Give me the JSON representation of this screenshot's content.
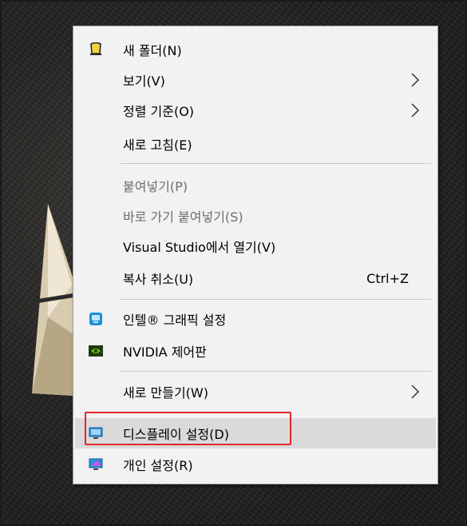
{
  "menu": {
    "items": [
      {
        "label": "새 폴더(N)",
        "icon": "folder-icon"
      },
      {
        "label": "보기(V)",
        "submenu": true
      },
      {
        "label": "정렬 기준(O)",
        "submenu": true
      },
      {
        "label": "새로 고침(E)"
      },
      {
        "label": "붙여넣기(P)",
        "disabled": true
      },
      {
        "label": "바로 가기 붙여넣기(S)",
        "disabled": true
      },
      {
        "label": "Visual Studio에서 열기(V)"
      },
      {
        "label": "복사 취소(U)",
        "shortcut": "Ctrl+Z"
      },
      {
        "label": "인텔® 그래픽 설정",
        "icon": "intel-graphics-icon"
      },
      {
        "label": "NVIDIA 제어판",
        "icon": "nvidia-icon"
      },
      {
        "label": "새로 만들기(W)",
        "submenu": true
      },
      {
        "label": "디스플레이 설정(D)",
        "icon": "display-icon",
        "highlighted": true
      },
      {
        "label": "개인 설정(R)",
        "icon": "personalize-icon"
      }
    ]
  },
  "colors": {
    "highlight_box": "#e0262a",
    "hover_background": "#dadada",
    "menu_background": "#f2f2f2",
    "disabled_text": "#6d6d6d"
  }
}
